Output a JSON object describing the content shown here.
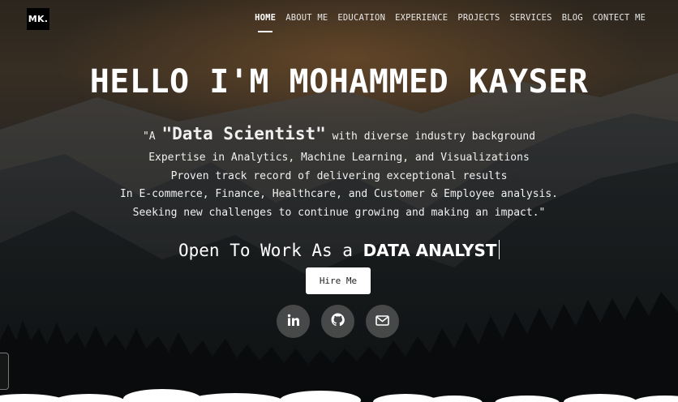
{
  "logo": {
    "text": "MK."
  },
  "nav": {
    "items": [
      {
        "label": "HOME",
        "active": true
      },
      {
        "label": "ABOUT ME",
        "active": false
      },
      {
        "label": "EDUCATION",
        "active": false
      },
      {
        "label": "EXPERIENCE",
        "active": false
      },
      {
        "label": "PROJECTS",
        "active": false
      },
      {
        "label": "SERVICES",
        "active": false
      },
      {
        "label": "BLOG",
        "active": false
      },
      {
        "label": "CONTECT ME",
        "active": false
      }
    ]
  },
  "hero": {
    "headline": "HELLO I'M MOHAMMED KAYSER",
    "intro_prefix": "\"A ",
    "intro_highlight": "\"Data Scientist\"",
    "intro_suffix": " with diverse industry background",
    "lines": [
      "Expertise in Analytics, Machine Learning, and Visualizations",
      "Proven track record of delivering exceptional results",
      "In E-commerce, Finance, Healthcare, and Customer & Employee analysis.",
      "Seeking new challenges to continue growing and making an impact.\""
    ],
    "open_prefix": "Open To Work As a ",
    "open_role": "DATA ANALYST",
    "hire_button": "Hire Me"
  },
  "socials": [
    {
      "icon": "linkedin-icon"
    },
    {
      "icon": "github-icon"
    },
    {
      "icon": "email-icon"
    }
  ],
  "colors": {
    "text": "#ffffff",
    "button_bg": "#ffffff",
    "button_text": "#222222",
    "social_bg": "#5a5a5a"
  }
}
